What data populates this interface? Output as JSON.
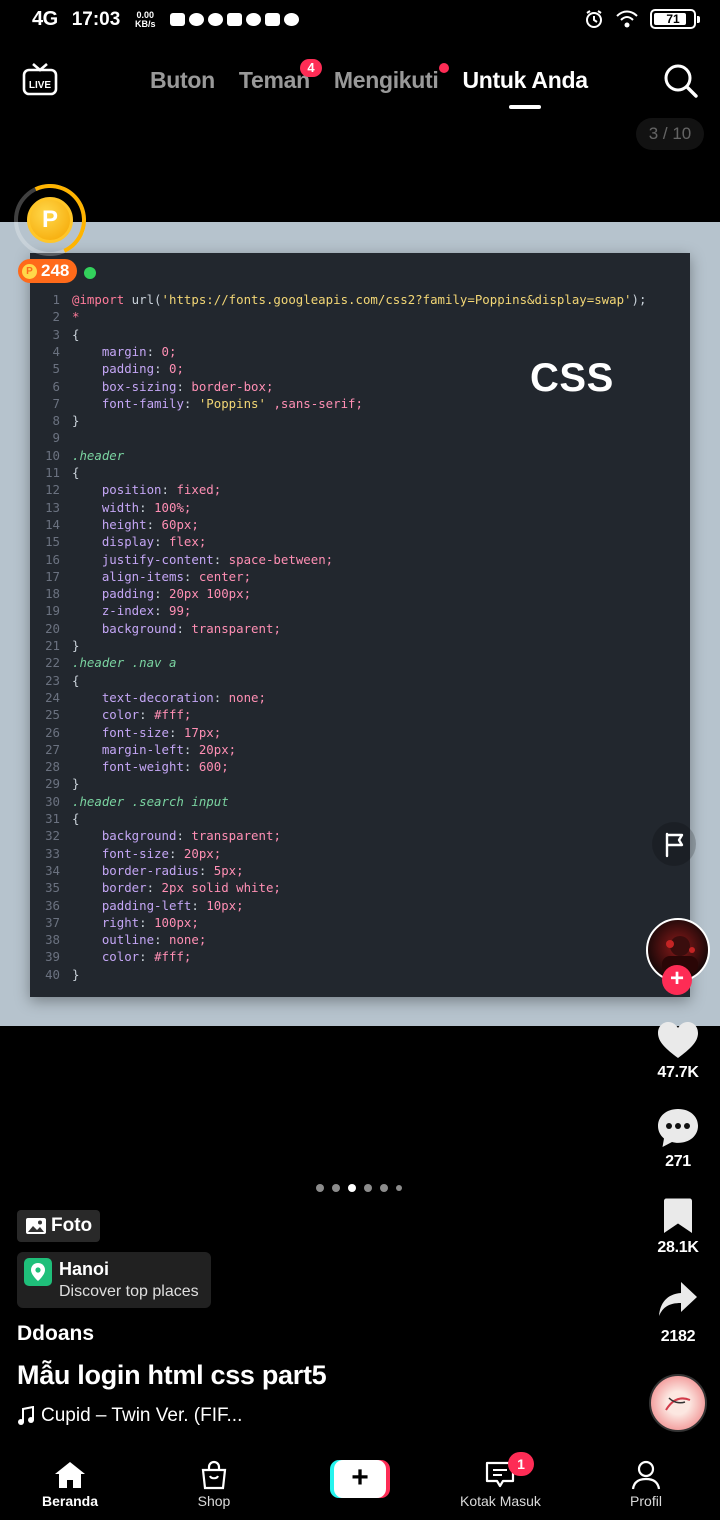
{
  "status_bar": {
    "network": "4G",
    "time": "17:03",
    "speed_value": "0.00",
    "speed_unit": "KB/s",
    "battery_level": "71"
  },
  "top_nav": {
    "live_label": "LIVE",
    "tabs": [
      {
        "label": "Buton"
      },
      {
        "label": "Teman",
        "badge": "4"
      },
      {
        "label": "Mengikuti"
      },
      {
        "label": "Untuk Anda"
      }
    ],
    "active_tab": "Untuk Anda",
    "photo_counter": "3 / 10"
  },
  "coin_widget": {
    "coin_symbol": "P",
    "points": "248"
  },
  "photo": {
    "overlay_label": "CSS",
    "code_lines": [
      "@import url('https://fonts.googleapis.com/css2?family=Poppins&display=swap');",
      "*",
      "{",
      "    margin: 0;",
      "    padding: 0;",
      "    box-sizing: border-box;",
      "    font-family: 'Poppins' ,sans-serif;",
      "}",
      "",
      ".header",
      "{",
      "    position: fixed;",
      "    width: 100%;",
      "    height: 60px;",
      "    display: flex;",
      "    justify-content: space-between;",
      "    align-items: center;",
      "    padding: 20px 100px;",
      "    z-index: 99;",
      "    background: transparent;",
      "}",
      ".header .nav a",
      "{",
      "    text-decoration: none;",
      "    color: #fff;",
      "    font-size: 17px;",
      "    margin-left: 20px;",
      "    font-weight: 600;",
      "}",
      ".header .search input",
      "{",
      "    background: transparent;",
      "    font-size: 20px;",
      "    border-radius: 5px;",
      "    border: 2px solid white;",
      "    padding-left: 10px;",
      "    right: 100px;",
      "    outline: none;",
      "    color: #fff;",
      "}"
    ]
  },
  "right_rail": {
    "likes": "47.7K",
    "comments": "271",
    "saves": "28.1K",
    "shares": "2182"
  },
  "carousel": {
    "total": 6,
    "active_index": 2
  },
  "post": {
    "type_tag": "Foto",
    "location_name": "Hanoi",
    "location_sub": "Discover top places",
    "author": "Ddoans",
    "caption": "Mẫu login html css part5",
    "song": "Cupid – Twin Ver. (FIF..."
  },
  "bottom_nav": {
    "items": [
      {
        "label": "Beranda"
      },
      {
        "label": "Shop"
      },
      {
        "label": "Kotak Masuk",
        "badge": "1"
      },
      {
        "label": "Profil"
      }
    ],
    "create_symbol": "+"
  },
  "colors": {
    "accent": "#fe2c55",
    "cyan": "#25f4ee",
    "points_bg": "#ff6a1a",
    "code_bg": "#22272e",
    "photo_bg": "#b6c3cd"
  }
}
